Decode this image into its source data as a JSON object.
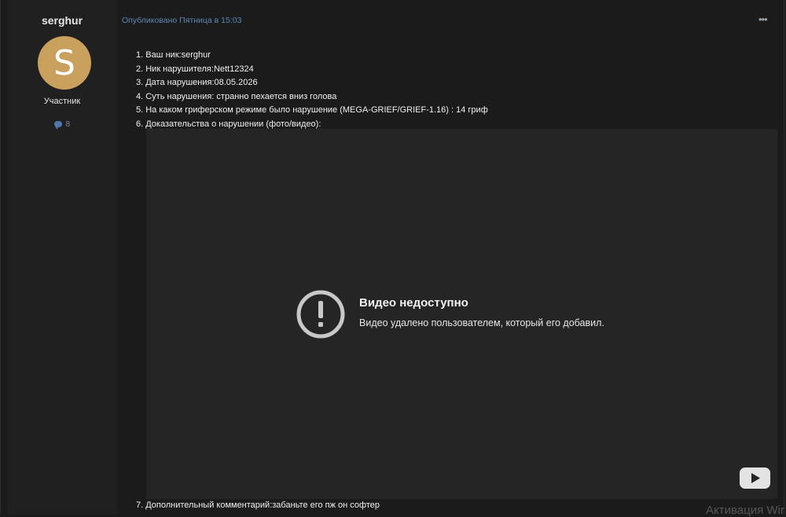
{
  "author": {
    "username": "serghur",
    "avatar_letter": "S",
    "avatar_color": "#c9a05c",
    "role": "Участник",
    "post_count": "8"
  },
  "post": {
    "meta": "Опубликовано Пятница в 15:03",
    "lines": [
      "1. Ваш ник:serghur",
      "2. Ник нарушителя:Nett12324",
      "3. Дата нарушения:08.05.2026",
      "4. Суть нарушения: странно пехается вниз голова",
      "5. На каком гриферском режиме было нарушение (MEGA-GRIEF/GRIEF-1.16) : 14 гриф",
      "6. Доказательства о нарушении (фото/видео):"
    ],
    "comment": "7. Дополнительный комментарий:забаньте его пж он софтер"
  },
  "video": {
    "title": "Видео недоступно",
    "subtitle": "Видео удалено пользователем, который его добавил.",
    "error_icon": "exclamation-circle-icon",
    "logo_icon": "youtube-icon"
  },
  "overlay": {
    "watermark": "Активация Wir"
  }
}
